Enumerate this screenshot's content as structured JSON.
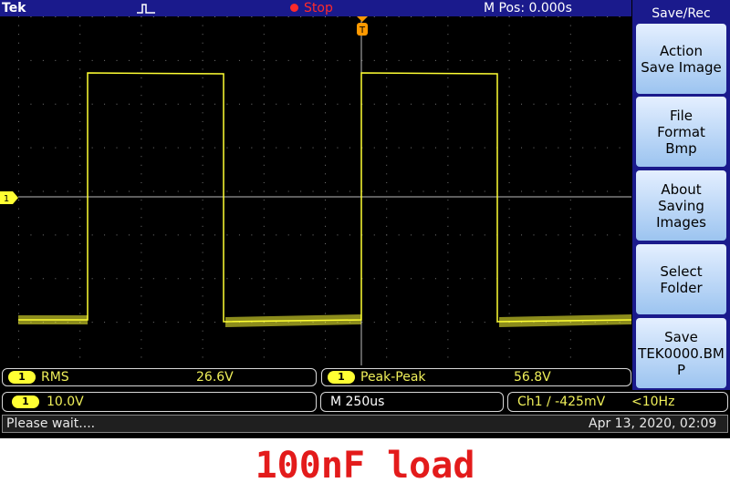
{
  "header": {
    "brand": "Tek",
    "run_state": "Stop",
    "horizontal_position": "M Pos: 0.000s"
  },
  "side_menu": {
    "title": "Save/Rec",
    "buttons": [
      {
        "label": "Action\nSave Image"
      },
      {
        "label": "File\nFormat\nBmp"
      },
      {
        "label": "About\nSaving\nImages"
      },
      {
        "label": "Select\nFolder"
      },
      {
        "label": "Save\nTEK0000.BM\nP"
      }
    ]
  },
  "channel_marker": "1",
  "trigger_marker": "T",
  "measurements": [
    {
      "channel": "1",
      "name": "RMS",
      "value": "26.6V"
    },
    {
      "channel": "1",
      "name": "Peak-Peak",
      "value": "56.8V"
    }
  ],
  "settings": {
    "channel": "1",
    "volts_per_div": "10.0V",
    "timebase": "M 250us",
    "trigger": "Ch1 ∕ -425mV",
    "trigger_freq": "<10Hz"
  },
  "status": {
    "message": "Please wait....",
    "datetime": "Apr 13, 2020, 02:09"
  },
  "caption": "100nF load",
  "colors": {
    "trace": "#ffff33",
    "header": "#1a1a8c",
    "caption": "#e31b1b"
  }
}
